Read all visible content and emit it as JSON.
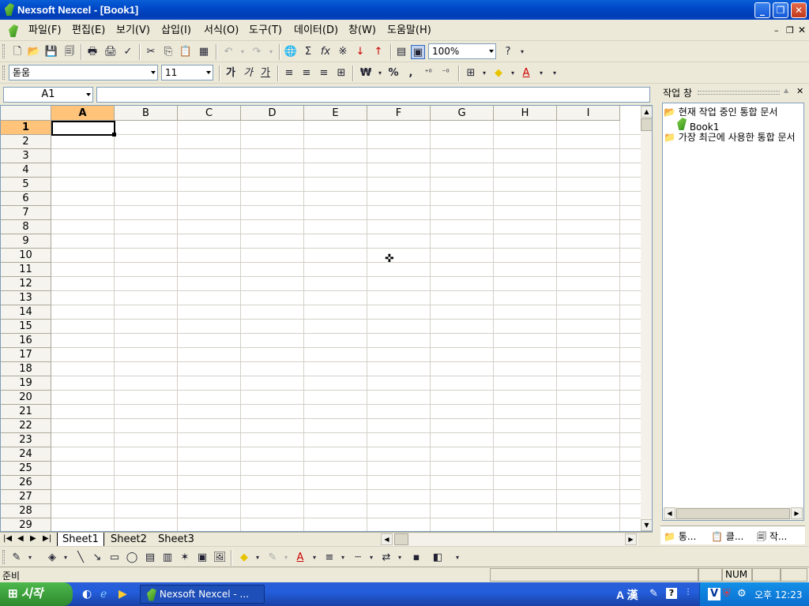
{
  "window": {
    "title": "Nexsoft Nexcel - [Book1]"
  },
  "menu": [
    "파일(F)",
    "편집(E)",
    "보기(V)",
    "삽입(I)",
    "서식(O)",
    "도구(T)",
    "데이터(D)",
    "창(W)",
    "도움말(H)"
  ],
  "toolbar": {
    "zoom": "100%"
  },
  "format": {
    "font": "돋움",
    "size": "11",
    "bold": "가",
    "italic": "가",
    "underline": "가",
    "currency": "₩",
    "percent": "%",
    "comma": ","
  },
  "formula": {
    "namebox": "A1"
  },
  "grid": {
    "columns": [
      "A",
      "B",
      "C",
      "D",
      "E",
      "F",
      "G",
      "H",
      "I"
    ],
    "rows": [
      "1",
      "2",
      "3",
      "4",
      "5",
      "6",
      "7",
      "8",
      "9",
      "10",
      "11",
      "12",
      "13",
      "14",
      "15",
      "16",
      "17",
      "18",
      "19",
      "20",
      "21",
      "22",
      "23",
      "24",
      "25",
      "26",
      "27",
      "28",
      "29"
    ],
    "selected_cell": "A1"
  },
  "sheets": [
    "Sheet1",
    "Sheet2",
    "Sheet3"
  ],
  "taskpane": {
    "title": "작업 창",
    "items": [
      "현재 작업 중인 통합 문서",
      "Book1",
      "가장 최근에 사용한 통합 문서"
    ],
    "tabs": [
      "통...",
      "클...",
      "작..."
    ]
  },
  "status": {
    "left": "준비",
    "num": "NUM"
  },
  "taskbar": {
    "start": "시작",
    "task": "Nexsoft Nexcel - ...",
    "clock": "오후 12:23",
    "ime": "A 漢"
  }
}
